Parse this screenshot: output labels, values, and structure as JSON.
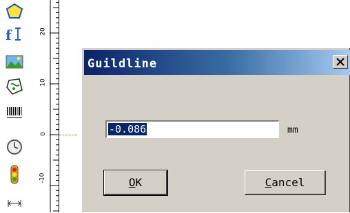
{
  "dialog": {
    "title": "Guildline",
    "value": "-0.086",
    "unit": "mm",
    "ok_label_u": "O",
    "ok_label_rest": "K",
    "cancel_label_u": "C",
    "cancel_label_rest": "ancel"
  },
  "ruler": {
    "labels": [
      "20",
      "10",
      "0",
      "-10"
    ]
  },
  "toolbar": {
    "icons": [
      "polygon-icon",
      "text-icon",
      "image-icon",
      "vectorize-icon",
      "barcode-icon",
      "clock-icon",
      "traffic-light-icon",
      "range-icon"
    ]
  },
  "colors": {
    "titlebar_start": "#0a246a",
    "titlebar_end": "#a6caf0",
    "dialog_face": "#d4d0c8"
  }
}
